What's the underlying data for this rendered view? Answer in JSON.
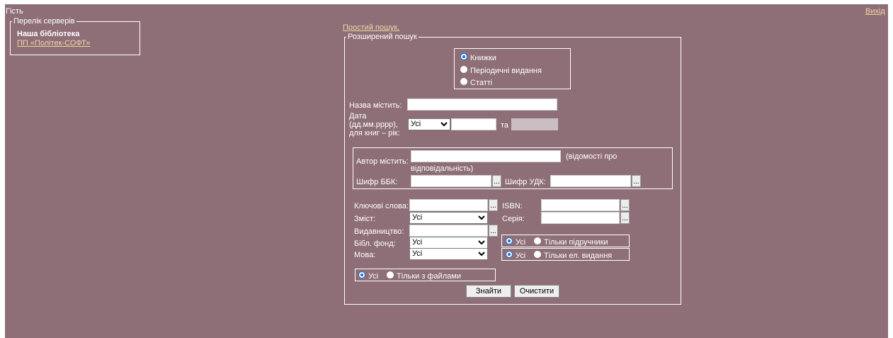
{
  "header": {
    "user": "Гість",
    "logout": "Вихід"
  },
  "servers": {
    "legend": "Перелік серверів",
    "current": "Наша бібліотека",
    "link": "ПП «Політек-СОФТ»"
  },
  "search": {
    "simple_link": "Простий пошук.",
    "legend": "Розширений пошук",
    "types": [
      {
        "label": "Книжки",
        "selected": true
      },
      {
        "label": "Періодичні видання",
        "selected": false
      },
      {
        "label": "Статті",
        "selected": false
      }
    ],
    "title_label": "Назва містить:",
    "date_label_1": "Дата",
    "date_label_2": "(дд.мм.рррр),",
    "date_label_3": "для книг – рік:",
    "date_select": "Усі",
    "date_and": "та",
    "author_label": "Автор містить:",
    "author_note_1": "(відомості про",
    "author_note_2": "відповідальність)",
    "bbk_label": "Шифр ББК:",
    "udk_label": "Шифр УДК:",
    "keywords_label": "Ключові слова:",
    "isbn_label": "ISBN:",
    "content_label": "Зміст:",
    "content_select": "Усі",
    "series_label": "Серія:",
    "publisher_label": "Видавництво:",
    "fund_label": "Бібл. фонд:",
    "fund_select": "Усі",
    "language_label": "Мова:",
    "language_select": "Усі",
    "textbooks": {
      "all": "Усі",
      "only": "Тільки підручники"
    },
    "electronic": {
      "all": "Усі",
      "only": "Тільки ел. видання"
    },
    "files": {
      "all": "Усі",
      "only": "Тільки з файлами"
    },
    "dots": "...",
    "find_button": "Знайти",
    "clear_button": "Очистити"
  }
}
